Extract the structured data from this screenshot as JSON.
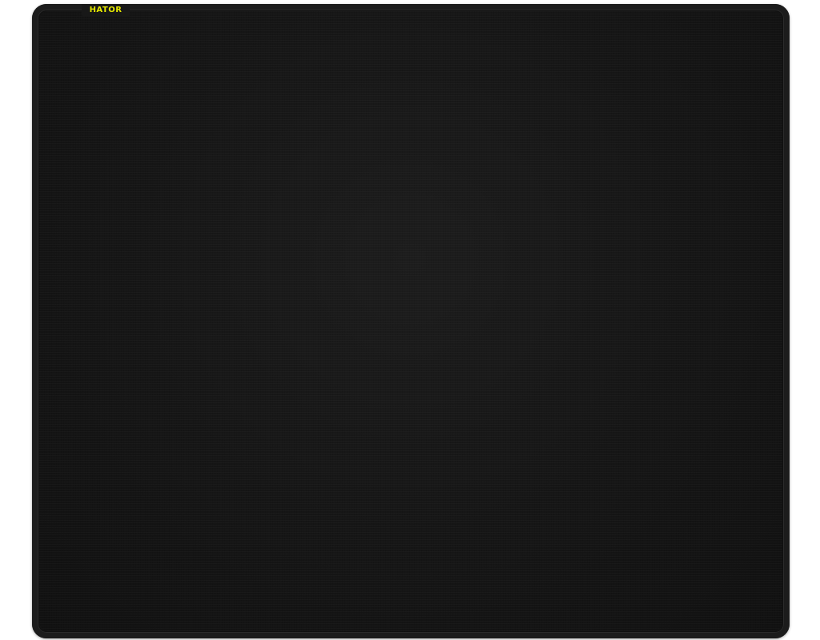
{
  "product": {
    "brand_label": "HATOR",
    "colors": {
      "pad": "#141414",
      "edge": "#1c1c1c",
      "brand_text": "#e3e600",
      "background": "#ffffff"
    }
  }
}
